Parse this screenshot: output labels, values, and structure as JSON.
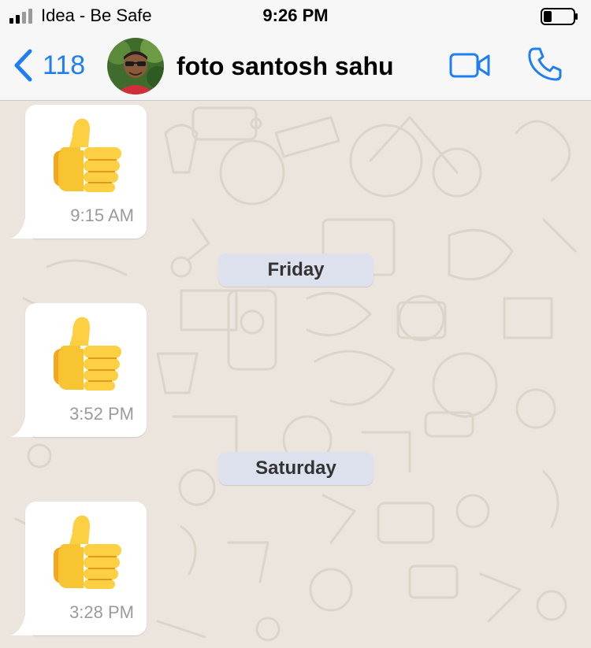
{
  "status_bar": {
    "carrier": "Idea - Be Safe",
    "time": "9:26 PM",
    "icons": [
      "signal-icon",
      "battery-icon"
    ]
  },
  "header": {
    "back_count": "118",
    "contact_name": "foto santosh sahu",
    "icons": [
      "chevron-left-icon",
      "video-call-icon",
      "phone-icon"
    ],
    "accent_color": "#1f7ff0"
  },
  "messages": [
    {
      "type": "incoming",
      "content": "thumbs-up-emoji",
      "time": "9:15 AM"
    },
    {
      "type": "date_separator",
      "label": "Friday"
    },
    {
      "type": "incoming",
      "content": "thumbs-up-emoji",
      "time": "3:52 PM"
    },
    {
      "type": "date_separator",
      "label": "Saturday"
    },
    {
      "type": "incoming",
      "content": "thumbs-up-emoji",
      "time": "3:28 PM"
    }
  ]
}
